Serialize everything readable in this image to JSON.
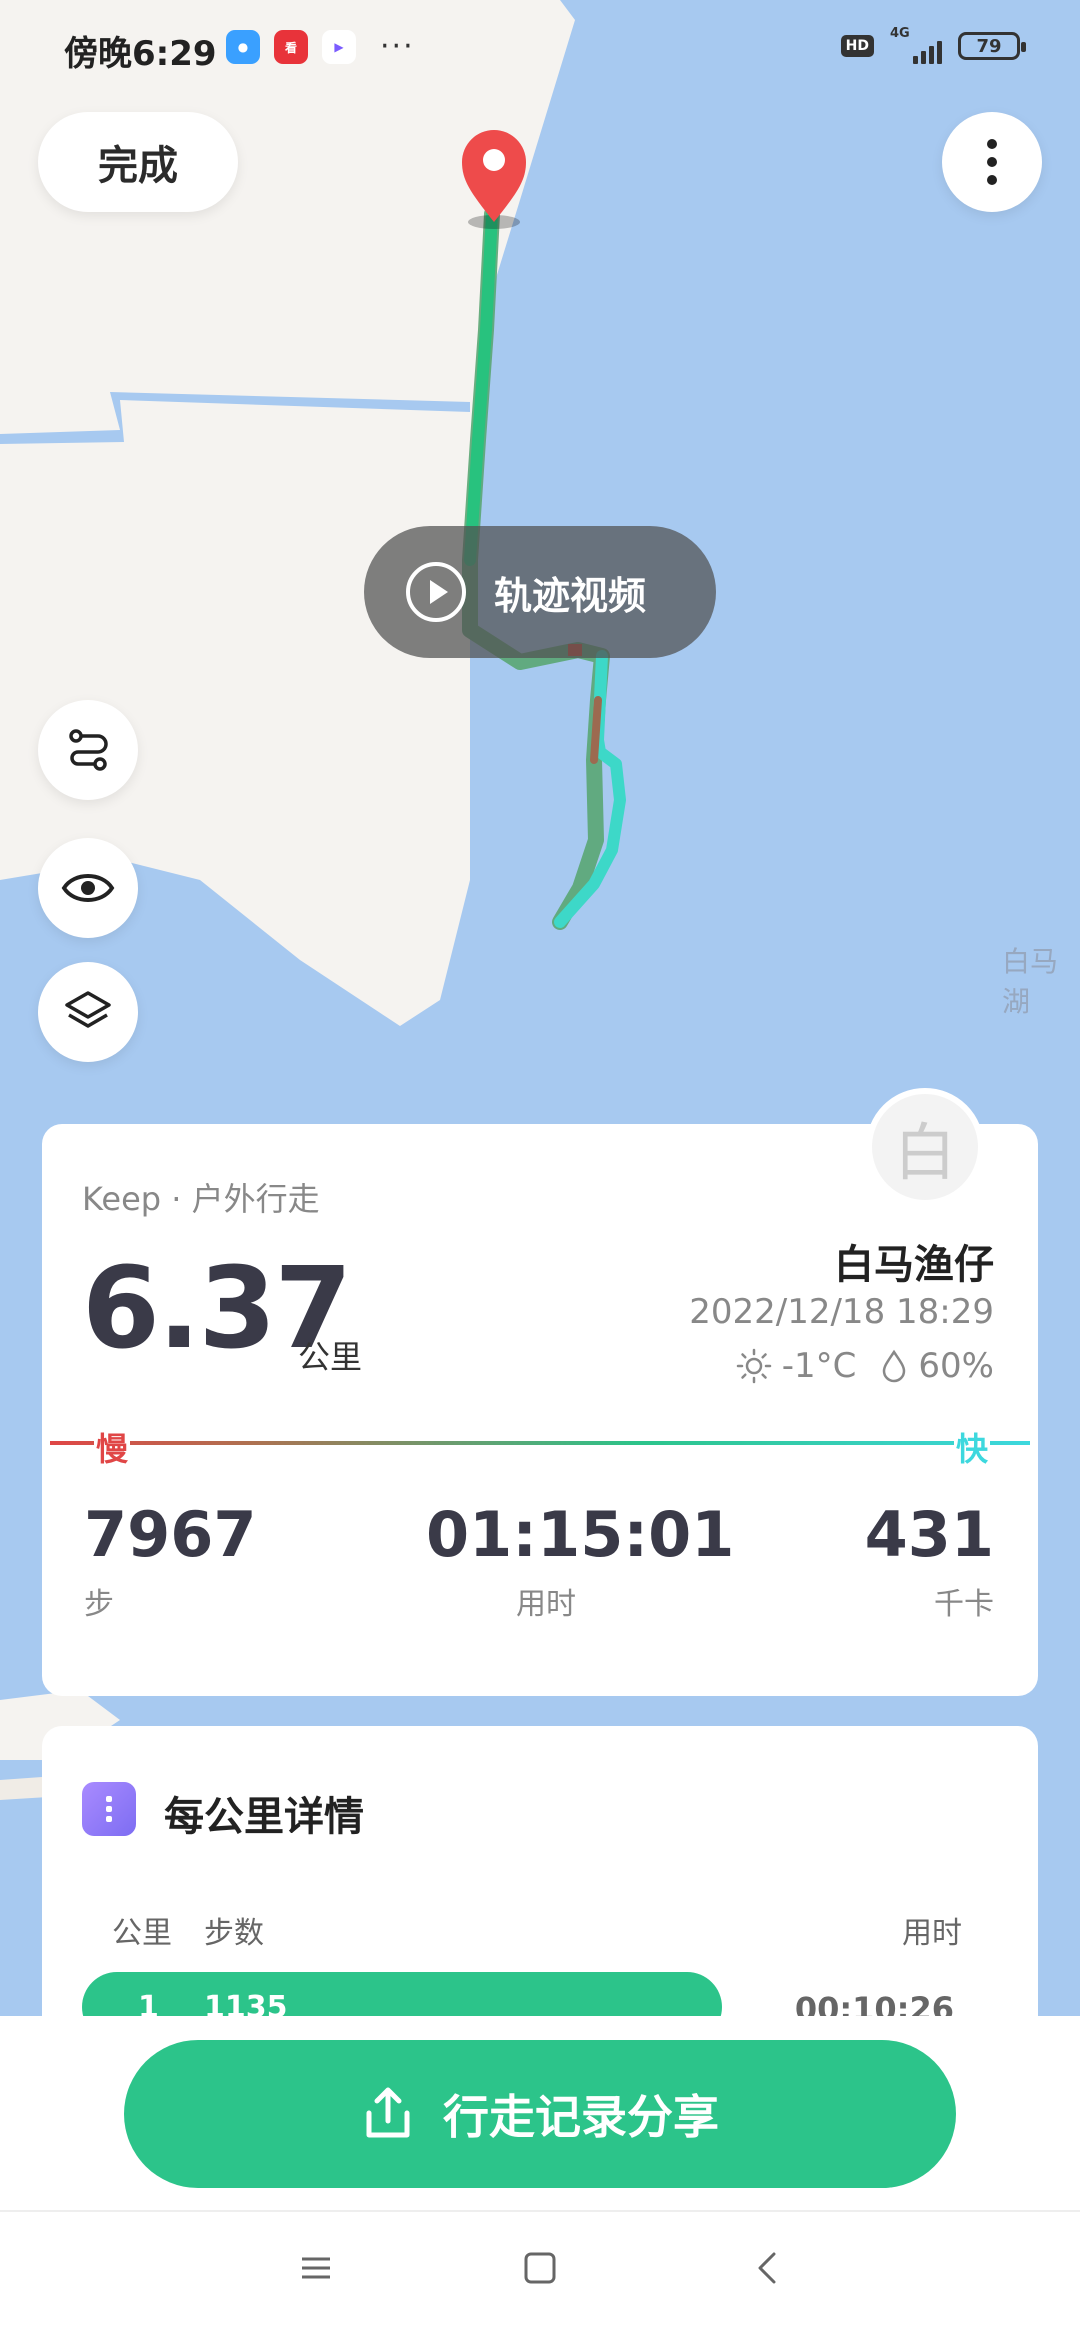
{
  "status_bar": {
    "time": "傍晚6:29",
    "battery": "79",
    "network": "4G",
    "hd": "HD"
  },
  "map": {
    "done_label": "完成",
    "video_label": "轨迹视频",
    "place_label": "白马湖"
  },
  "summary": {
    "source": "Keep · 户外行走",
    "distance": "6.37",
    "distance_unit": "公里",
    "user_name": "白马渔仔",
    "avatar_char": "白",
    "datetime": "2022/12/18 18:29",
    "temperature": "-1°C",
    "humidity": "60%",
    "pace_slow": "慢",
    "pace_fast": "快",
    "stats": [
      {
        "value": "7967",
        "label": "步"
      },
      {
        "value": "01:15:01",
        "label": "用时"
      },
      {
        "value": "431",
        "label": "千卡"
      }
    ]
  },
  "km_details": {
    "title": "每公里详情",
    "headers": {
      "km": "公里",
      "steps": "步数",
      "time": "用时"
    },
    "rows": [
      {
        "km": "1",
        "steps": "1135",
        "time": "00:10:26"
      }
    ]
  },
  "share_button": {
    "label": "行走记录分享"
  },
  "colors": {
    "accent": "#2cc48a",
    "slow": "#e04646",
    "fast": "#3dd8de",
    "water": "#a7c9f0",
    "land": "#f5f3f0"
  },
  "icons": [
    "route-icon",
    "eye-icon",
    "layers-icon",
    "play-icon",
    "share-icon",
    "location-pin-icon",
    "sun-icon",
    "humidity-icon"
  ]
}
